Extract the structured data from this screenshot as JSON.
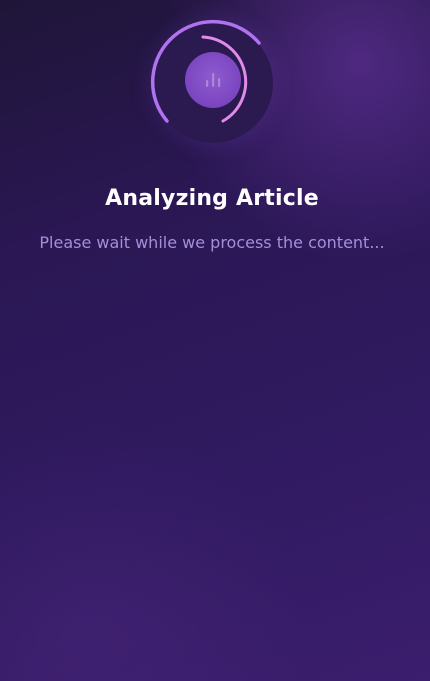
{
  "loader": {
    "icon": "bar-chart-icon",
    "accent_color": "#b072f0",
    "inner_arc_color": "#e28ae8",
    "badge_color": "#7a45bf"
  },
  "status": {
    "title": "Analyzing Article",
    "subtitle": "Please wait while we process the content..."
  }
}
